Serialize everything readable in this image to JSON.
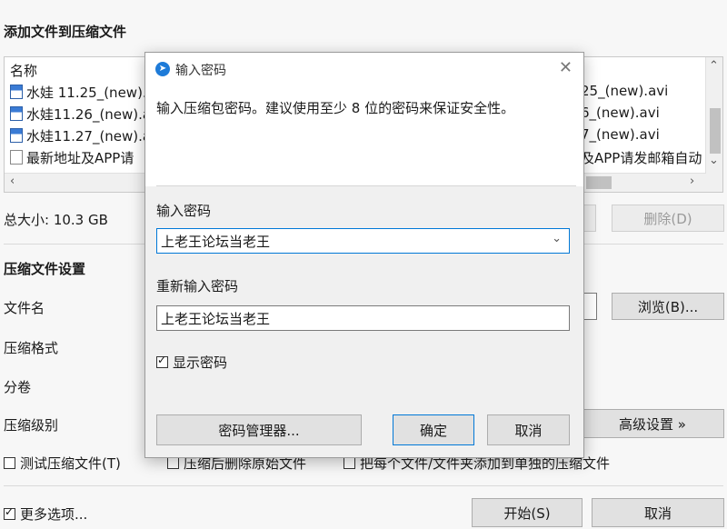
{
  "window": {
    "heading": "添加文件到压缩文件",
    "file_list": {
      "header_name": "名称",
      "rows": [
        {
          "name": "水娃 11.25_(new).",
          "right": "25_(new).avi",
          "icon": "video-file-icon"
        },
        {
          "name": "水娃11.26_(new).a",
          "right": "6_(new).avi",
          "icon": "video-file-icon"
        },
        {
          "name": "水娃11.27_(new).a",
          "right": "7_(new).avi",
          "icon": "video-file-icon"
        },
        {
          "name": "最新地址及APP请",
          "right": "及APP请发邮箱自动",
          "icon": "document-file-icon"
        }
      ]
    },
    "total_size": "总大小: 10.3 GB",
    "delete_button": "删除(D)",
    "settings_heading": "压缩文件设置",
    "filename_label": "文件名",
    "browse_button": "浏览(B)...",
    "format_label": "压缩格式",
    "split_label": "分卷",
    "level_label": "压缩级别",
    "advanced_button": "高级设置 »",
    "checkbox_test": "测试压缩文件(T)",
    "checkbox_delete_after": "压缩后删除原始文件",
    "checkbox_separate": "把每个文件/文件夹添加到单独的压缩文件",
    "more_options": "更多选项...",
    "start_button": "开始(S)",
    "cancel_button": "取消"
  },
  "dialog": {
    "title": "输入密码",
    "description": "输入压缩包密码。建议使用至少 8 位的密码来保证安全性。",
    "password_label": "输入密码",
    "password_value": "上老王论坛当老王",
    "reenter_label": "重新输入密码",
    "reenter_value": "上老王论坛当老王",
    "show_password": "显示密码",
    "show_password_checked": true,
    "manager_button": "密码管理器...",
    "ok_button": "确定",
    "cancel_button": "取消"
  }
}
